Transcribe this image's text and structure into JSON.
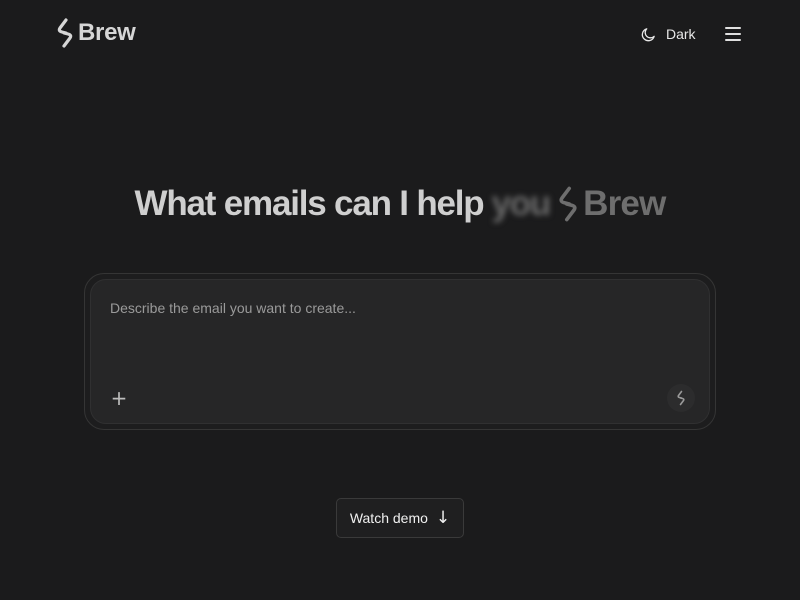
{
  "header": {
    "logo_text": "Brew",
    "theme_label": "Dark",
    "theme_icon": "moon-icon",
    "menu_icon": "hamburger-icon"
  },
  "hero": {
    "headline_main": "What emails can I help",
    "headline_ghost": "you",
    "headline_brand": "Brew"
  },
  "prompt": {
    "placeholder": "Describe the email you want to create...",
    "add_icon": "plus-icon",
    "add_glyph": "+",
    "send_icon": "brew-logo-icon"
  },
  "demo": {
    "label": "Watch demo",
    "arrow": "↓",
    "arrow_icon": "arrow-down-icon"
  },
  "colors": {
    "background": "#1b1b1c",
    "prompt_background": "#262627",
    "text": "#e6e6e6",
    "muted_text": "#9a9a9a"
  }
}
